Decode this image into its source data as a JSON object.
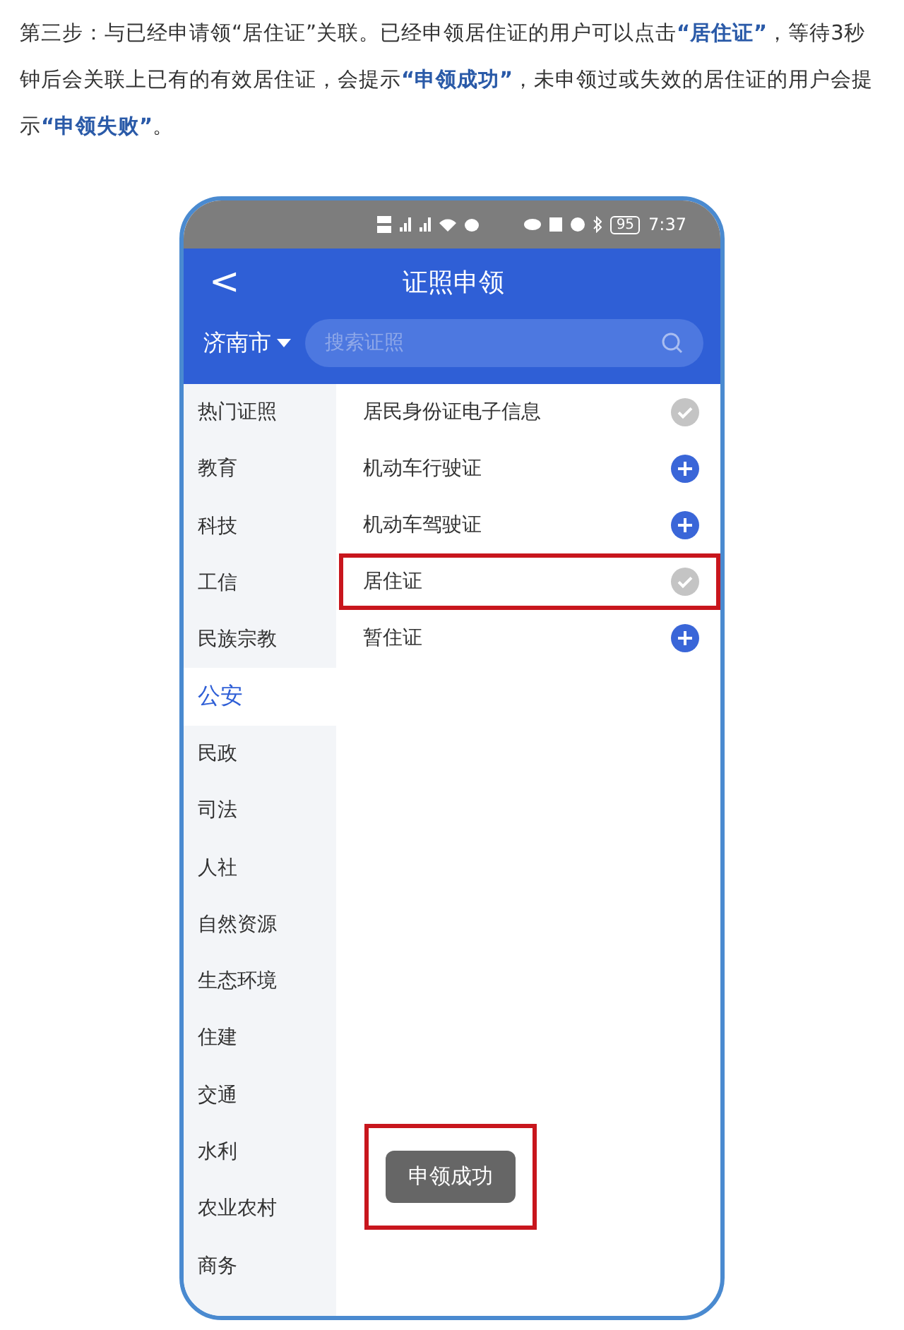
{
  "article": {
    "paragraph": "第三步：与已经申请领“居住证”关联。已经申领居住证的用户可以点击**“居住证”**，等待3秒钟后会关联上已有的有效居住证，会提示**“申领成功”**，未申领过或失效的居住证的用户会提示**“申领失败”**。"
  },
  "phone": {
    "status_bar": {
      "battery": "95",
      "time": "7:37"
    },
    "header": {
      "back": "<",
      "title": "证照申领"
    },
    "city": "济南市",
    "search": {
      "placeholder": "搜索证照"
    },
    "sidebar": [
      {
        "label": "热门证照",
        "selected": false
      },
      {
        "label": "教育",
        "selected": false
      },
      {
        "label": "科技",
        "selected": false
      },
      {
        "label": "工信",
        "selected": false
      },
      {
        "label": "民族宗教",
        "selected": false
      },
      {
        "label": "公安",
        "selected": true
      },
      {
        "label": "民政",
        "selected": false
      },
      {
        "label": "司法",
        "selected": false
      },
      {
        "label": "人社",
        "selected": false
      },
      {
        "label": "自然资源",
        "selected": false
      },
      {
        "label": "生态环境",
        "selected": false
      },
      {
        "label": "住建",
        "selected": false
      },
      {
        "label": "交通",
        "selected": false
      },
      {
        "label": "水利",
        "selected": false
      },
      {
        "label": "农业农村",
        "selected": false
      },
      {
        "label": "商务",
        "selected": false
      }
    ],
    "licenses": [
      {
        "label": "居民身份证电子信息",
        "applied": true,
        "highlighted": false
      },
      {
        "label": "机动车行驶证",
        "applied": false,
        "highlighted": false
      },
      {
        "label": "机动车驾驶证",
        "applied": false,
        "highlighted": false
      },
      {
        "label": "居住证",
        "applied": true,
        "highlighted": true
      },
      {
        "label": "暂住证",
        "applied": false,
        "highlighted": false
      }
    ],
    "toast": {
      "text": "申领成功",
      "highlighted": true
    }
  }
}
